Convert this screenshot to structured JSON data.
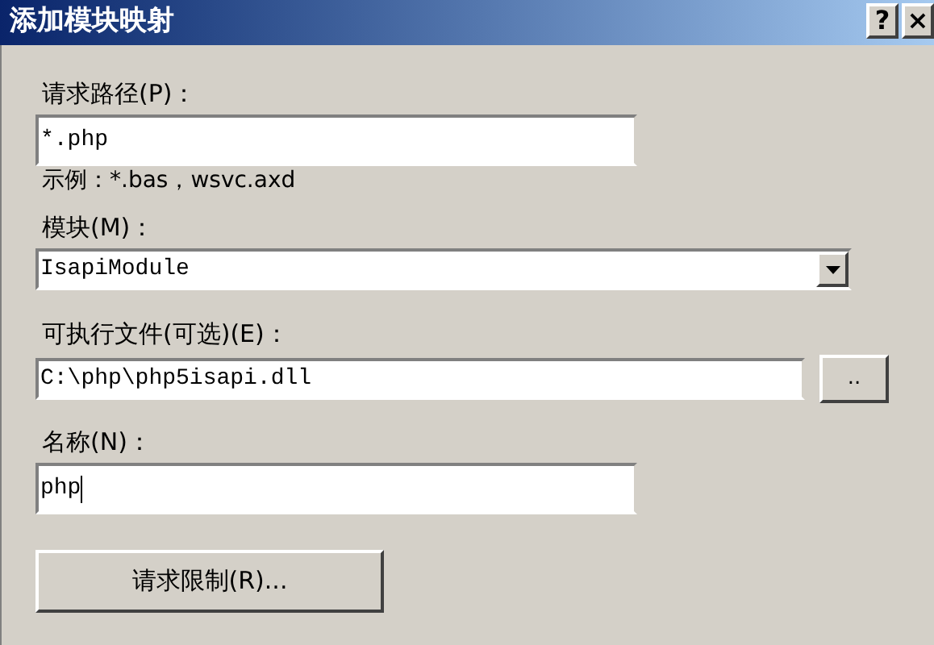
{
  "window": {
    "title": "添加模块映射",
    "buttons": [
      "?",
      "×"
    ]
  },
  "fields": [
    {
      "kind": "text",
      "label": "请求路径(P)：",
      "value": "*.php",
      "hint": "示例：*.bas，wsvc.axd"
    },
    {
      "kind": "select",
      "label": "模块(M)：",
      "value": "IsapiModule"
    },
    {
      "kind": "browse",
      "label": "可执行文件(可选)(E)：",
      "value": "C:\\php\\php5isapi.dll",
      "button": ".."
    },
    {
      "kind": "text",
      "label": "名称(N)：",
      "value": "php",
      "focused": true
    }
  ],
  "buttons": [
    "请求限制(R)..."
  ]
}
